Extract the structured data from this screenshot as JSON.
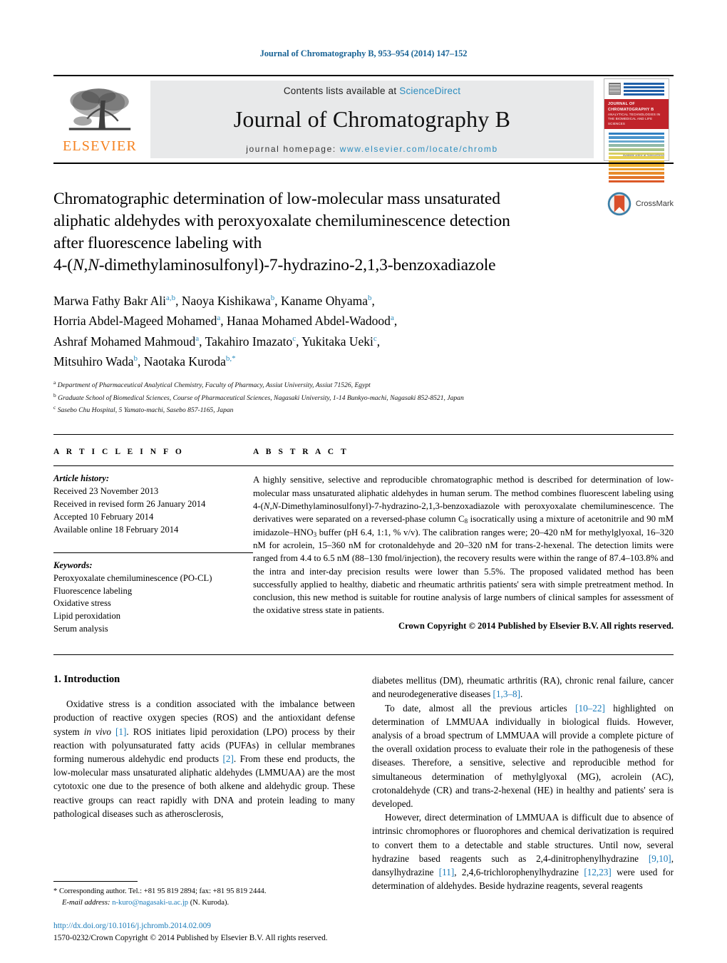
{
  "running_head": "Journal of Chromatography B, 953–954 (2014) 147–152",
  "masthead": {
    "contents_prefix": "Contents lists available at ",
    "sciencedirect": "ScienceDirect",
    "journal_name": "Journal of Chromatography B",
    "homepage_prefix": "journal homepage: ",
    "homepage_url": "www.elsevier.com/locate/chromb",
    "publisher": "ELSEVIER",
    "cover_title": "JOURNAL OF CHROMATOGRAPHY B",
    "cover_subtitle": "ANALYTICAL TECHNOLOGIES IN THE BIOMEDICAL AND LIFE SCIENCES",
    "cover_sciencedirect": "Available online at ScienceDirect"
  },
  "crossmark": {
    "label": "CrossMark"
  },
  "article": {
    "title_line1": "Chromatographic determination of low-molecular mass unsaturated",
    "title_line2": "aliphatic aldehydes with peroxyoxalate chemiluminescence detection",
    "title_line3": "after fluorescence labeling with",
    "title_line4_pre": "4-(",
    "title_line4_italic": "N,N",
    "title_line4_post": "-dimethylaminosulfonyl)-7-hydrazino-2,1,3-benzoxadiazole"
  },
  "authors": [
    {
      "name": "Marwa Fathy Bakr Ali",
      "sup": "a,b",
      "sep": ","
    },
    {
      "name": "Naoya Kishikawa",
      "sup": "b",
      "sep": ","
    },
    {
      "name": "Kaname Ohyama",
      "sup": "b",
      "sep": ","
    },
    {
      "name": "Horria Abdel-Mageed Mohamed",
      "sup": "a",
      "sep": ","
    },
    {
      "name": "Hanaa Mohamed Abdel-Wadood",
      "sup": "a",
      "sep": ","
    },
    {
      "name": "Ashraf Mohamed Mahmoud",
      "sup": "a",
      "sep": ","
    },
    {
      "name": "Takahiro Imazato",
      "sup": "c",
      "sep": ","
    },
    {
      "name": "Yukitaka Ueki",
      "sup": "c",
      "sep": ","
    },
    {
      "name": "Mitsuhiro Wada",
      "sup": "b",
      "sep": ","
    },
    {
      "name": "Naotaka Kuroda",
      "sup": "b,*",
      "sep": ""
    }
  ],
  "affiliations": [
    {
      "marker": "a",
      "text": "Department of Pharmaceutical Analytical Chemistry, Faculty of Pharmacy, Assiut University, Assiut 71526, Egypt"
    },
    {
      "marker": "b",
      "text": "Graduate School of Biomedical Sciences, Course of Pharmaceutical Sciences, Nagasaki University, 1-14 Bunkyo-machi, Nagasaki 852-8521, Japan"
    },
    {
      "marker": "c",
      "text": "Sasebo Chu Hospital, 5 Yamato-machi, Sasebo 857-1165, Japan"
    }
  ],
  "article_info": {
    "heading": "A R T I C L E   I N F O",
    "history_label": "Article history:",
    "history": [
      "Received 23 November 2013",
      "Received in revised form 26 January 2014",
      "Accepted 10 February 2014",
      "Available online 18 February 2014"
    ],
    "keywords_label": "Keywords:",
    "keywords": [
      "Peroxyoxalate chemiluminescence (PO-CL)",
      "Fluorescence labeling",
      "Oxidative stress",
      "Lipid peroxidation",
      "Serum analysis"
    ]
  },
  "abstract": {
    "heading": "A B S T R A C T",
    "part1": "A highly sensitive, selective and reproducible chromatographic method is described for determination of low-molecular mass unsaturated aliphatic aldehydes in human serum. The method combines fluorescent labeling using 4-(",
    "italic1": "N,N",
    "part2": "-Dimethylaminosulfonyl)-7-hydrazino-2,1,3-benzoxadiazole with peroxyoxalate chemiluminescence. The derivatives were separated on a reversed-phase column C",
    "sub1": "8",
    "part3": " isocratically using a mixture of acetonitrile and 90 mM imidazole–HNO",
    "sub2": "3",
    "part4": " buffer (pH 6.4, 1:1, % v/v). The calibration ranges were; 20–420 nM for methylglyoxal, 16–320 nM for acrolein, 15–360 nM for crotonaldehyde and 20–320 nM for trans-2-hexenal. The detection limits were ranged from 4.4 to 6.5 nM (88–130 fmol/injection), the recovery results were within the range of 87.4–103.8% and the intra and inter-day precision results were lower than 5.5%. The proposed validated method has been successfully applied to healthy, diabetic and rheumatic arthritis patients' sera with simple pretreatment method. In conclusion, this new method is suitable for routine analysis of large numbers of clinical samples for assessment of the oxidative stress state in patients.",
    "copyright": "Crown Copyright © 2014 Published by Elsevier B.V. All rights reserved."
  },
  "introduction": {
    "heading": "1.  Introduction",
    "left_p1_a": "Oxidative stress is a condition associated with the imbalance between production of reactive oxygen species (ROS) and the antioxidant defense system ",
    "left_p1_italic": "in vivo",
    "left_p1_b": " ",
    "left_p1_ref1": "[1]",
    "left_p1_c": ". ROS initiates lipid peroxidation (LPO) process by their reaction with polyunsaturated fatty acids (PUFAs) in cellular membranes forming numerous aldehydic end products ",
    "left_p1_ref2": "[2]",
    "left_p1_d": ". From these end products, the low-molecular mass unsaturated aliphatic aldehydes (LMMUAA) are the most cytotoxic one due to the presence of both alkene and aldehydic group. These reactive groups can react rapidly with DNA and protein leading to many pathological diseases such as atherosclerosis,",
    "right_p1_a": "diabetes mellitus (DM), rheumatic arthritis (RA), chronic renal failure, cancer and neurodegenerative diseases ",
    "right_p1_ref": "[1,3–8]",
    "right_p1_b": ".",
    "right_p2_a": "To date, almost all the previous articles ",
    "right_p2_ref": "[10–22]",
    "right_p2_b": " highlighted on determination of LMMUAA individually in biological fluids. However, analysis of a broad spectrum of LMMUAA will provide a complete picture of the overall oxidation process to evaluate their role in the pathogenesis of these diseases. Therefore, a sensitive, selective and reproducible method for simultaneous determination of methylglyoxal (MG), acrolein (AC), crotonaldehyde (CR) and trans-2-hexenal (HE) in healthy and patients' sera is developed.",
    "right_p3_a": "However, direct determination of LMMUAA is difficult due to absence of intrinsic chromophores or fluorophores and chemical derivatization is required to convert them to a detectable and stable structures. Until now, several hydrazine based reagents such as 2,4-dinitrophenylhydrazine ",
    "right_p3_ref1": "[9,10]",
    "right_p3_b": ", dansylhydrazine ",
    "right_p3_ref2": "[11]",
    "right_p3_c": ", 2,4,6-trichlorophenylhydrazine ",
    "right_p3_ref3": "[12,23]",
    "right_p3_d": " were used for determination of aldehydes. Beside hydrazine reagents, several reagents"
  },
  "footnote": {
    "star": "*",
    "corresponding": "Corresponding author. Tel.: +81 95 819 2894; fax: +81 95 819 2444.",
    "email_label": "E-mail address:",
    "email": "n-kuro@nagasaki-u.ac.jp",
    "email_owner": "(N. Kuroda)."
  },
  "doi_block": {
    "doi": "http://dx.doi.org/10.1016/j.jchromb.2014.02.009",
    "issn": "1570-0232/Crown Copyright © 2014 Published by Elsevier B.V. All rights reserved."
  },
  "colors": {
    "link": "#1a7bb9",
    "elsevier_orange": "#f58220",
    "sciencedirect_blue": "#2b8cbe",
    "running_head_blue": "#1a6496",
    "cover_red": "#c0232a"
  }
}
